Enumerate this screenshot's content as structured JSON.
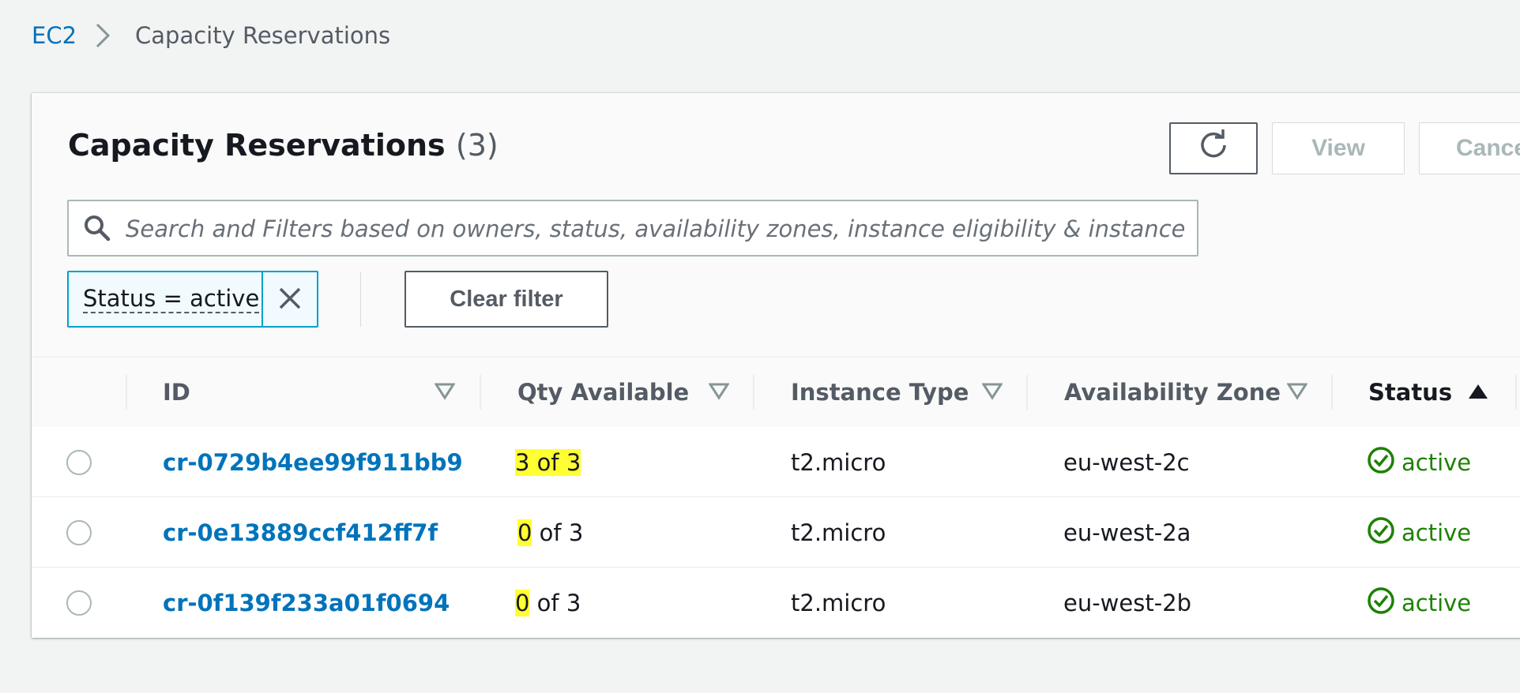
{
  "breadcrumb": {
    "parent": "EC2",
    "current": "Capacity Reservations"
  },
  "header": {
    "title": "Capacity Reservations",
    "count": "(3)"
  },
  "actions": {
    "view_label": "View",
    "cancel_label": "Cance"
  },
  "search": {
    "placeholder": "Search and Filters based on owners, status, availability zones, instance eligibility & instance type"
  },
  "filter_token": {
    "label": "Status = active"
  },
  "clear_filter_label": "Clear filter",
  "columns": {
    "id": "ID",
    "qty": "Qty Available",
    "type": "Instance Type",
    "zone": "Availability Zone",
    "status": "Status"
  },
  "rows": [
    {
      "id": "cr-0729b4ee99f911bb9",
      "qty_highlight": "3 of 3",
      "qty_rest": "",
      "type": "t2.micro",
      "zone": "eu-west-2c",
      "status": "active"
    },
    {
      "id": "cr-0e13889ccf412ff7f",
      "qty_highlight": "0",
      "qty_rest": " of 3",
      "type": "t2.micro",
      "zone": "eu-west-2a",
      "status": "active"
    },
    {
      "id": "cr-0f139f233a01f0694",
      "qty_highlight": "0",
      "qty_rest": " of 3",
      "type": "t2.micro",
      "zone": "eu-west-2b",
      "status": "active"
    }
  ],
  "colors": {
    "link": "#0073bb",
    "status_ok": "#1d8102",
    "highlight": "#ffff33",
    "token_border": "#00a1c9"
  },
  "icons": {
    "breadcrumb_separator": "chevron-right-icon",
    "refresh": "refresh-icon",
    "search": "search-icon",
    "token_remove": "close-icon",
    "sort_inactive": "sort-down-outline-icon",
    "sort_active": "sort-up-filled-icon",
    "status": "check-circle-icon"
  }
}
